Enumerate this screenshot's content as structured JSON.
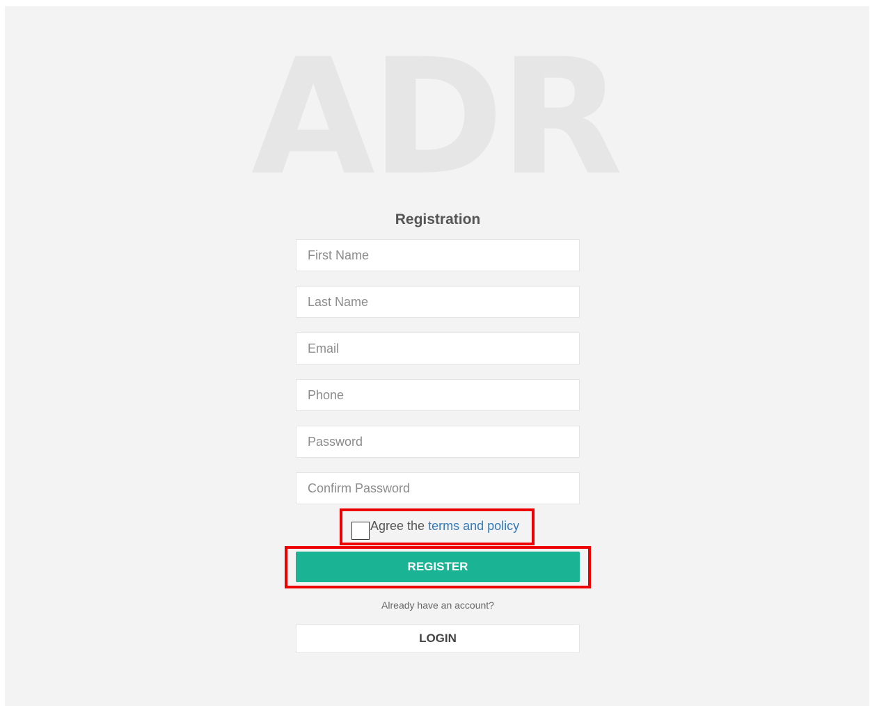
{
  "logo_text": "ADR",
  "form": {
    "title": "Registration",
    "fields": {
      "first_name": {
        "placeholder": "First Name",
        "value": ""
      },
      "last_name": {
        "placeholder": "Last Name",
        "value": ""
      },
      "email": {
        "placeholder": "Email",
        "value": ""
      },
      "phone": {
        "placeholder": "Phone",
        "value": ""
      },
      "password": {
        "placeholder": "Password",
        "value": ""
      },
      "confirm_password": {
        "placeholder": "Confirm Password",
        "value": ""
      }
    },
    "agree": {
      "prefix": "Agree the ",
      "link_text": "terms and policy",
      "checked": false
    },
    "register_label": "REGISTER",
    "already_text": "Already have an account?",
    "login_label": "LOGIN"
  },
  "colors": {
    "primary": "#1ab394",
    "link": "#337ab7",
    "highlight": "#ee0000",
    "background": "#f3f3f3"
  }
}
